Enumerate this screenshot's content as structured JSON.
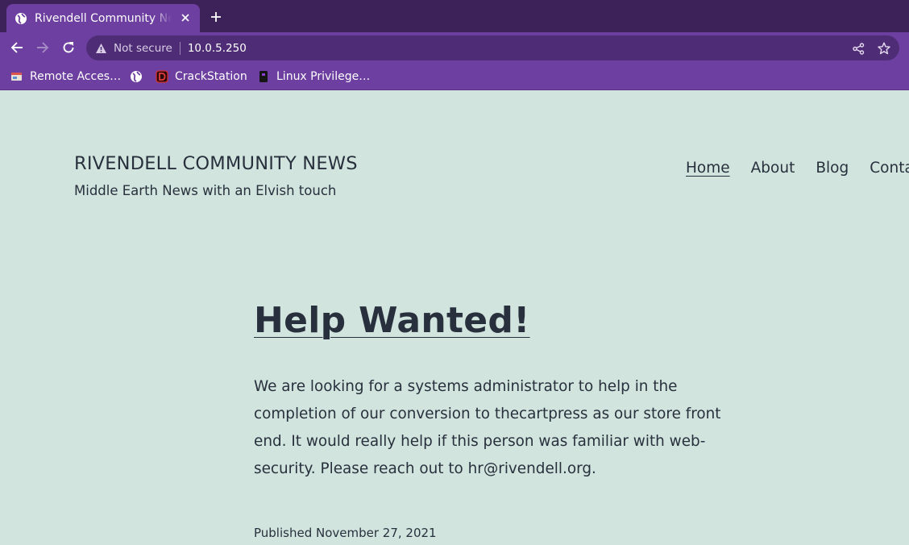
{
  "browser": {
    "tab": {
      "title": "Rivendell Community News",
      "favicon": "globe-icon"
    },
    "address": {
      "security_label": "Not secure",
      "url": "10.0.5.250"
    },
    "bookmarks": [
      {
        "label": "Remote Acces…",
        "icon": "remote-access-icon"
      },
      {
        "label": "",
        "icon": "globe-icon"
      },
      {
        "label": "CrackStation",
        "icon": "crackstation-icon"
      },
      {
        "label": "Linux Privilege…",
        "icon": "linux-icon"
      }
    ],
    "colors": {
      "frame": "#3d2159",
      "toolbar": "#6d3fa0",
      "omnibox": "#4f2d76"
    }
  },
  "site": {
    "title": "RIVENDELL COMMUNITY NEWS",
    "description": "Middle Earth News with an Elvish touch",
    "menu": [
      "Home",
      "About",
      "Blog",
      "Conta"
    ],
    "background": "#d1e4dd",
    "text_color": "#28303d"
  },
  "post": {
    "title": "Help Wanted!",
    "body": "We are looking for a systems administrator to help in the completion of our conversion to thecartpress as our store front end. It would really help if this person was familiar with web-security. Please reach out to hr@rivendell.org.",
    "published_prefix": "Published",
    "date": "November 27, 2021"
  }
}
